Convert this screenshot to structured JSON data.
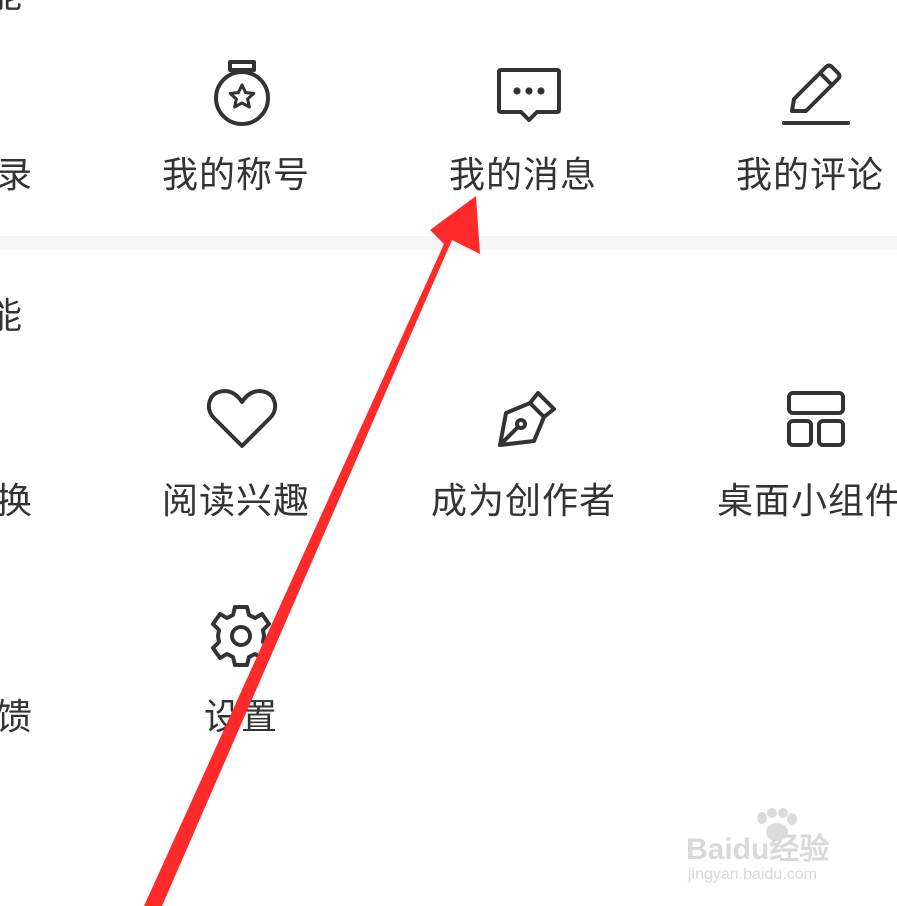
{
  "colors": {
    "divider": "#f5f5f5",
    "icon": "#333333",
    "annotation_arrow": "#ff2a2a"
  },
  "top_section": {
    "clipped_heading": "能",
    "clipped_left_label": "录",
    "items": [
      {
        "icon": "medal-icon",
        "label": "我的称号"
      },
      {
        "icon": "message-bubble-icon",
        "label": "我的消息"
      },
      {
        "icon": "pencil-icon",
        "label": "我的评论"
      }
    ]
  },
  "bottom_section": {
    "clipped_heading": "能",
    "clipped_left_labels": [
      "换",
      "馈"
    ],
    "items": [
      {
        "icon": "heart-icon",
        "label": "阅读兴趣"
      },
      {
        "icon": "pen-nib-icon",
        "label": "成为创作者"
      },
      {
        "icon": "widget-layout-icon",
        "label": "桌面小组件"
      },
      {
        "icon": "gear-icon",
        "label": "设置"
      }
    ]
  },
  "watermark": {
    "brand": "Baidu经验",
    "url": "jingyan.baidu.com",
    "icon": "paw-icon"
  }
}
